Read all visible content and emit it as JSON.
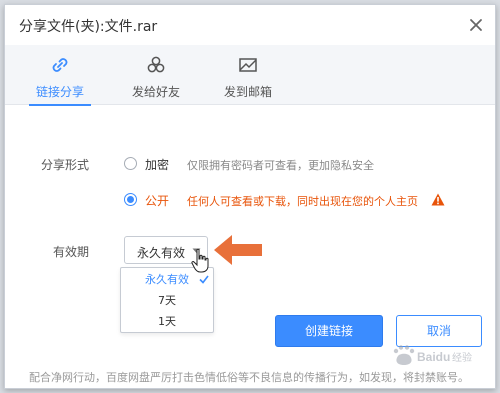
{
  "dialog": {
    "title": "分享文件(夹):文件.rar"
  },
  "tabs": [
    {
      "label": "链接分享",
      "icon": "link-icon",
      "active": true
    },
    {
      "label": "发给好友",
      "icon": "friends-icon",
      "active": false
    },
    {
      "label": "发到邮箱",
      "icon": "mail-icon",
      "active": false
    }
  ],
  "share_form": {
    "label": "分享形式",
    "options": [
      {
        "label": "加密",
        "description": "仅限拥有密码者可查看，更加隐私安全",
        "checked": false
      },
      {
        "label": "公开",
        "description": "任何人可查看或下载，同时出现在您的个人主页",
        "checked": true
      }
    ]
  },
  "validity": {
    "label": "有效期",
    "selected": "永久有效",
    "options": [
      "永久有效",
      "7天",
      "1天"
    ]
  },
  "buttons": {
    "create": "创建链接",
    "cancel": "取消"
  },
  "notice": "配合净网行动，百度网盘严厉打击色情低俗等不良信息的传播行为，如发现，将封禁账号。",
  "colors": {
    "accent": "#3b8cff",
    "warning": "#e8540a",
    "annotation_arrow": "#e8703a"
  }
}
